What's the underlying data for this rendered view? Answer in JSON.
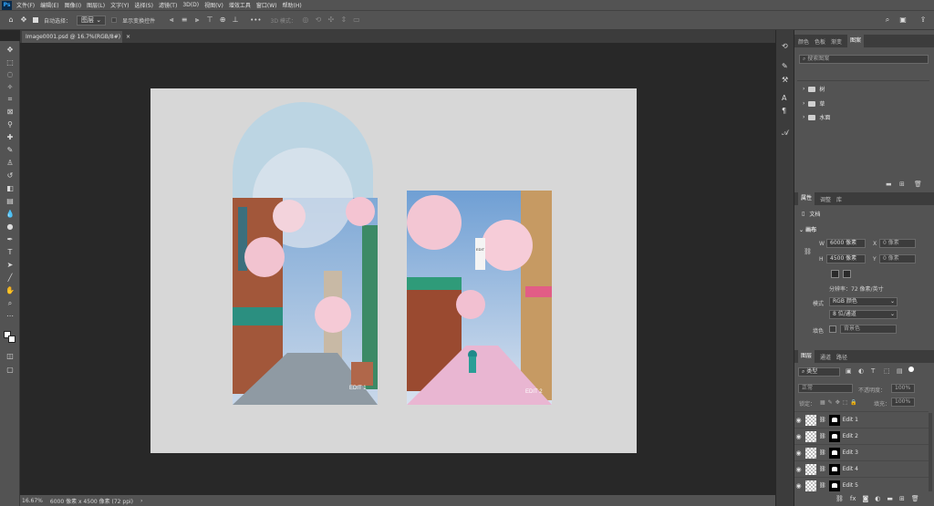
{
  "menubar": {
    "app_badge": "Ps",
    "items": [
      "文件(F)",
      "编辑(E)",
      "图像(I)",
      "图层(L)",
      "文字(Y)",
      "选择(S)",
      "滤镜(T)",
      "3D(D)",
      "视图(V)",
      "增效工具",
      "窗口(W)",
      "帮助(H)"
    ]
  },
  "options": {
    "auto_select": "自动选择：",
    "auto_select_target": "图层",
    "transform_controls": "显示变换控件",
    "more": "•••",
    "mode_3d": "3D 模式："
  },
  "document": {
    "tab_title": "Image0001.psd @ 16.7%(RGB/8#)"
  },
  "canvas": {
    "left_card_label": "EDIT 1",
    "right_card_label": "EDIT 2",
    "right_sign_text": "EDIT"
  },
  "status": {
    "zoom": "16.67%",
    "size": "6000 像素 x 4500 像素 (72 ppi)"
  },
  "panel_top": {
    "tabs": [
      "颜色",
      "色板",
      "渐变",
      "图案"
    ],
    "search_placeholder": "搜索图案",
    "groups": [
      "树",
      "草",
      "水面"
    ]
  },
  "properties": {
    "tabs": [
      "属性",
      "调整",
      "库"
    ],
    "doc_label": "文档",
    "canvas_header": "画布",
    "w_label": "W",
    "w_value": "6000 像素",
    "x_label": "X",
    "x_value": "0 像素",
    "h_label": "H",
    "h_value": "4500 像素",
    "y_label": "Y",
    "y_value": "0 像素",
    "resolution": "分辨率：72 像素/英寸",
    "mode_label": "模式",
    "mode_value": "RGB 颜色",
    "depth_value": "8 位/通道",
    "fill_label": "填色",
    "fill_value": "背景色"
  },
  "layers": {
    "tabs": [
      "图层",
      "通道",
      "路径"
    ],
    "filter_type": "类型",
    "blend_mode": "正常",
    "opacity_label": "不透明度：",
    "opacity_value": "100%",
    "lock_label": "锁定：",
    "fill_label": "填充：",
    "fill_value": "100%",
    "items": [
      "Edit 1",
      "Edit 2",
      "Edit 3",
      "Edit 4",
      "Edit 5"
    ],
    "footer": "fx"
  }
}
